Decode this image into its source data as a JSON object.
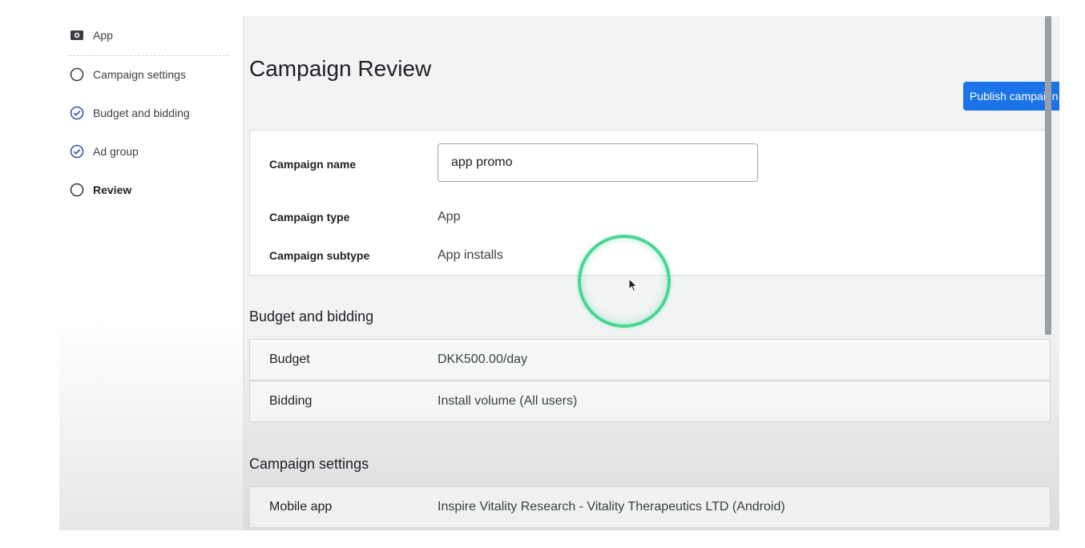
{
  "sidebar": {
    "items": [
      {
        "label": "App",
        "icon": "app-icon",
        "state": "app"
      },
      {
        "label": "Campaign settings",
        "icon": "circle-icon",
        "state": "incomplete"
      },
      {
        "label": "Budget and bidding",
        "icon": "check-circle-icon",
        "state": "complete"
      },
      {
        "label": "Ad group",
        "icon": "check-circle-icon",
        "state": "complete"
      },
      {
        "label": "Review",
        "icon": "circle-icon",
        "state": "current"
      }
    ]
  },
  "header": {
    "title": "Campaign Review",
    "publish_label": "Publish campaign"
  },
  "campaign": {
    "name_label": "Campaign name",
    "name_value": "app promo",
    "type_label": "Campaign type",
    "type_value": "App",
    "subtype_label": "Campaign subtype",
    "subtype_value": "App installs"
  },
  "budget_section": {
    "heading": "Budget and bidding",
    "rows": [
      {
        "label": "Budget",
        "value": "DKK500.00/day"
      },
      {
        "label": "Bidding",
        "value": "Install volume (All users)"
      }
    ]
  },
  "settings_section": {
    "heading": "Campaign settings",
    "rows": [
      {
        "label": "Mobile app",
        "value": "Inspire Vitality Research - Vitality Therapeutics LTD (Android)"
      }
    ]
  },
  "colors": {
    "accent": "#1a73e8",
    "cursor_highlight": "#47d694"
  }
}
